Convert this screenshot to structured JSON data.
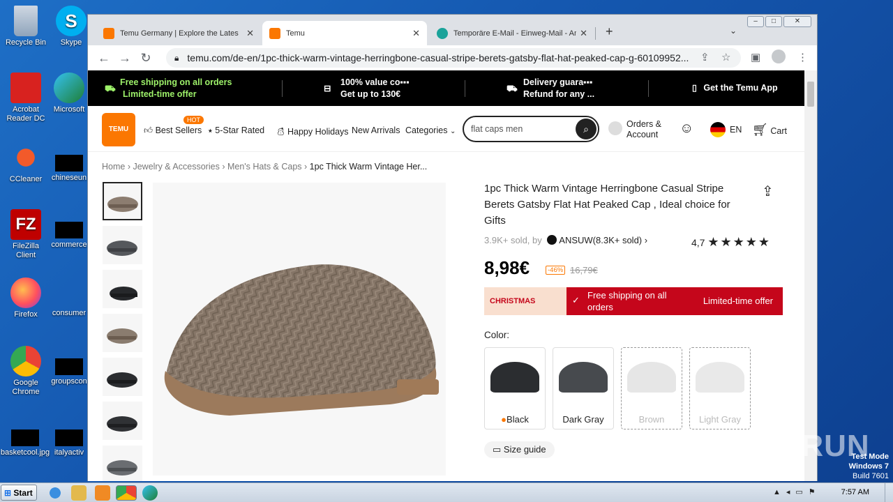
{
  "desktop": {
    "icons": [
      {
        "label": "Recycle Bin"
      },
      {
        "label": "Skype"
      },
      {
        "label": "Acrobat Reader DC"
      },
      {
        "label": "Microsoft"
      },
      {
        "label": "CCleaner"
      },
      {
        "label": "chineseun"
      },
      {
        "label": "FileZilla Client"
      },
      {
        "label": "commerce"
      },
      {
        "label": "Firefox"
      },
      {
        "label": "consumer"
      },
      {
        "label": "Google Chrome"
      },
      {
        "label": "groupscon"
      },
      {
        "label": "basketcool.jpg"
      },
      {
        "label": "italyactiv"
      }
    ]
  },
  "browser": {
    "tabs": [
      {
        "title": "Temu Germany | Explore the Latest C"
      },
      {
        "title": "Temu"
      },
      {
        "title": "Temporäre E-Mail - Einweg-Mail - Anc"
      }
    ],
    "url": "temu.com/de-en/1pc-thick-warm-vintage-herringbone-casual-stripe-berets-gatsby-flat-hat-peaked-cap-g-60109952..."
  },
  "promo": {
    "shipping_title": "Free shipping on all orders",
    "shipping_sub": "Limited-time offer",
    "value_title": "100% value co▪▪▪",
    "value_sub": "Get up to 130€",
    "delivery_title": "Delivery guara▪▪▪",
    "delivery_sub": "Refund for any ...",
    "app": "Get the Temu App"
  },
  "header": {
    "logo": "TEMU",
    "hot": "HOT",
    "nav": [
      "Best Sellers",
      "5-Star Rated",
      "Happy Holidays",
      "New Arrivals",
      "Categories"
    ],
    "search_value": "flat caps men",
    "orders_line1": "Orders &",
    "orders_line2": "Account",
    "lang": "EN",
    "cart": "Cart"
  },
  "breadcrumb": [
    "Home",
    "Jewelry & Accessories",
    "Men's Hats & Caps",
    "1pc Thick Warm Vintage Her..."
  ],
  "product": {
    "title": "1pc Thick Warm Vintage Herringbone Casual Stripe Berets Gatsby Flat Hat Peaked Cap , Ideal choice for Gifts",
    "sold": "3.9K+ sold, by",
    "shop": "ANSUW(8.3K+ sold)",
    "rating": "4,7",
    "stars": 4.7,
    "price": "8,98€",
    "discount": "-46%",
    "old_price": "16,79€",
    "banner_tag": "CHRISTMAS",
    "banner_text": "Free shipping on all orders",
    "banner_offer": "Limited-time offer",
    "color_label": "Color:",
    "colors": [
      {
        "name": "Black",
        "hex": "#2b2d30"
      },
      {
        "name": "Dark Gray",
        "hex": "#474a4e"
      },
      {
        "name": "Brown",
        "hex": "#e6e6e6"
      },
      {
        "name": "Light Gray",
        "hex": "#e9e9e9"
      }
    ],
    "size_guide": "Size guide"
  },
  "watermark": {
    "brand": "ANY RUN",
    "test_mode": "Test Mode",
    "os": "Windows 7",
    "build": "Build 7601"
  },
  "taskbar": {
    "start": "Start",
    "clock": "7:57 AM"
  }
}
